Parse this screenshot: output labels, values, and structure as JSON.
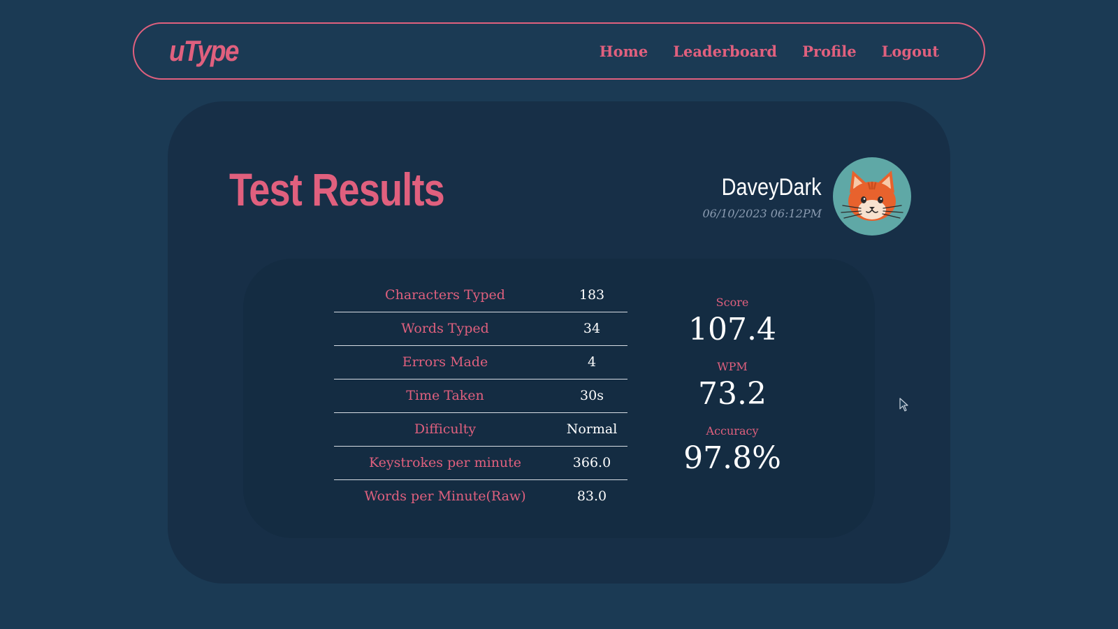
{
  "nav": {
    "logo": "uType",
    "links": [
      "Home",
      "Leaderboard",
      "Profile",
      "Logout"
    ]
  },
  "header": {
    "title": "Test Results",
    "username": "DaveyDark",
    "timestamp": "06/10/2023 06:12PM",
    "avatar_icon": "cat-avatar-icon"
  },
  "stats": {
    "rows": [
      {
        "label": "Characters Typed",
        "value": "183"
      },
      {
        "label": "Words Typed",
        "value": "34"
      },
      {
        "label": "Errors Made",
        "value": "4"
      },
      {
        "label": "Time Taken",
        "value": "30s"
      },
      {
        "label": "Difficulty",
        "value": "Normal"
      },
      {
        "label": "Keystrokes per minute",
        "value": "366.0"
      },
      {
        "label": "Words per Minute(Raw)",
        "value": "83.0"
      }
    ]
  },
  "metrics": {
    "score_label": "Score",
    "score_value": "107.4",
    "wpm_label": "WPM",
    "wpm_value": "73.2",
    "accuracy_label": "Accuracy",
    "accuracy_value": "97.8%"
  },
  "colors": {
    "background": "#1b3a54",
    "card": "#172f47",
    "panel": "#142c42",
    "accent": "#e0607e",
    "avatar_bg": "#5fa8a6"
  }
}
